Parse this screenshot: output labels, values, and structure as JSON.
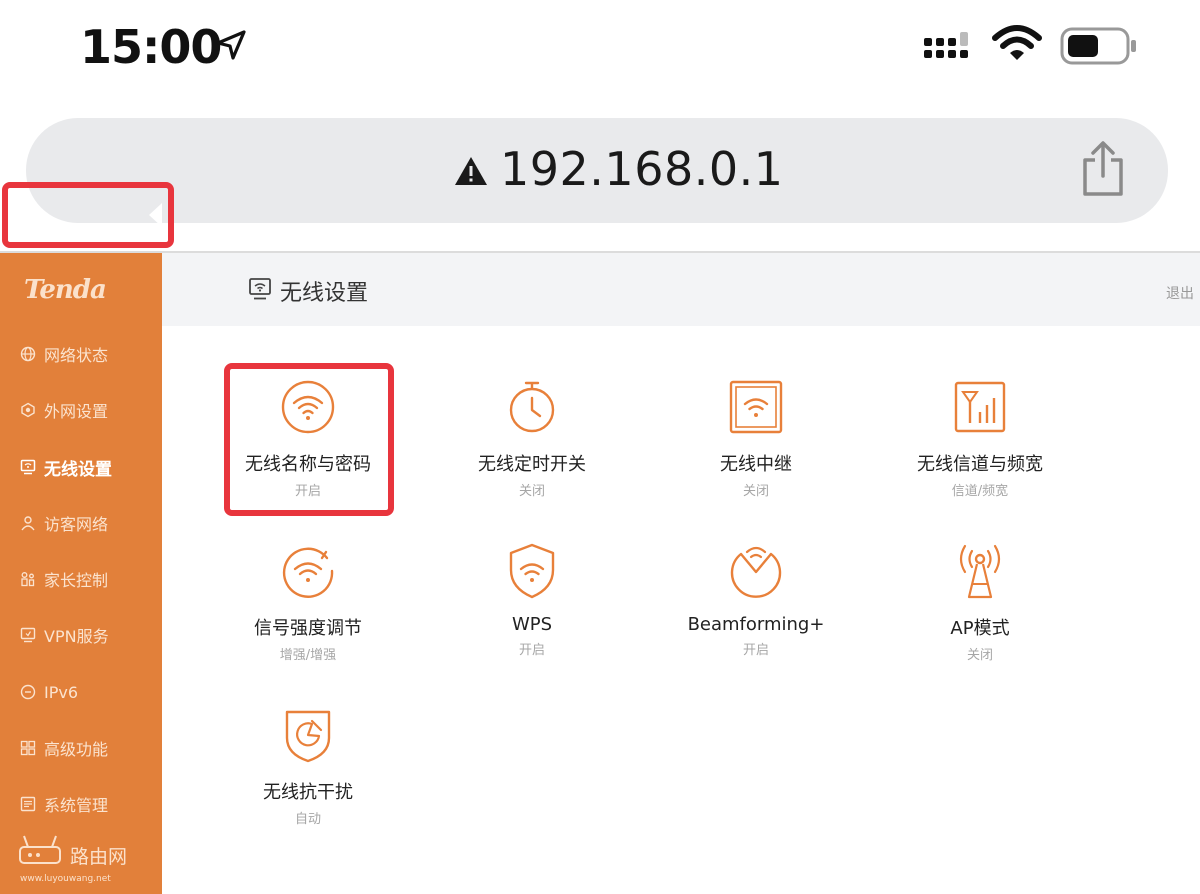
{
  "status_bar": {
    "time": "15:00",
    "icons": [
      "location-arrow-icon",
      "cellular-signal-icon",
      "wifi-icon",
      "battery-icon"
    ]
  },
  "address_bar": {
    "url": "192.168.0.1",
    "warning_icon": "warning-triangle-icon",
    "share_icon": "share-icon"
  },
  "sidebar": {
    "logo": "Tenda",
    "items": [
      {
        "label": "网络状态",
        "icon": "globe-icon"
      },
      {
        "label": "外网设置",
        "icon": "network-hex-icon"
      },
      {
        "label": "无线设置",
        "icon": "wireless-monitor-icon",
        "active": true
      },
      {
        "label": "访客网络",
        "icon": "guest-user-icon"
      },
      {
        "label": "家长控制",
        "icon": "parental-icon"
      },
      {
        "label": "VPN服务",
        "icon": "vpn-monitor-icon"
      },
      {
        "label": "IPv6",
        "icon": "ipv6-icon"
      },
      {
        "label": "高级功能",
        "icon": "grid-icon"
      },
      {
        "label": "系统管理",
        "icon": "system-settings-icon"
      }
    ],
    "watermark": {
      "name": "路由网",
      "url": "www.luyouwang.net"
    }
  },
  "header": {
    "title": "无线设置",
    "logout": "退出"
  },
  "tiles": [
    {
      "label": "无线名称与密码",
      "status": "开启",
      "icon": "wifi-circle-icon"
    },
    {
      "label": "无线定时开关",
      "status": "关闭",
      "icon": "stopwatch-icon"
    },
    {
      "label": "无线中继",
      "status": "关闭",
      "icon": "wifi-square-icon"
    },
    {
      "label": "无线信道与频宽",
      "status": "信道/频宽",
      "icon": "channel-bars-icon"
    },
    {
      "label": "信号强度调节",
      "status": "增强/增强",
      "icon": "wifi-dial-icon"
    },
    {
      "label": "WPS",
      "status": "开启",
      "icon": "wifi-shield-icon"
    },
    {
      "label": "Beamforming+",
      "status": "开启",
      "icon": "beamforming-icon"
    },
    {
      "label": "AP模式",
      "status": "关闭",
      "icon": "antenna-icon"
    },
    {
      "label": "无线抗干扰",
      "status": "自动",
      "icon": "anti-interference-icon"
    }
  ],
  "colors": {
    "sidebar_bg": "#e2803a",
    "accent_orange": "#e8803a",
    "highlight_red": "#e8353d",
    "header_bg": "#f3f4f6"
  }
}
